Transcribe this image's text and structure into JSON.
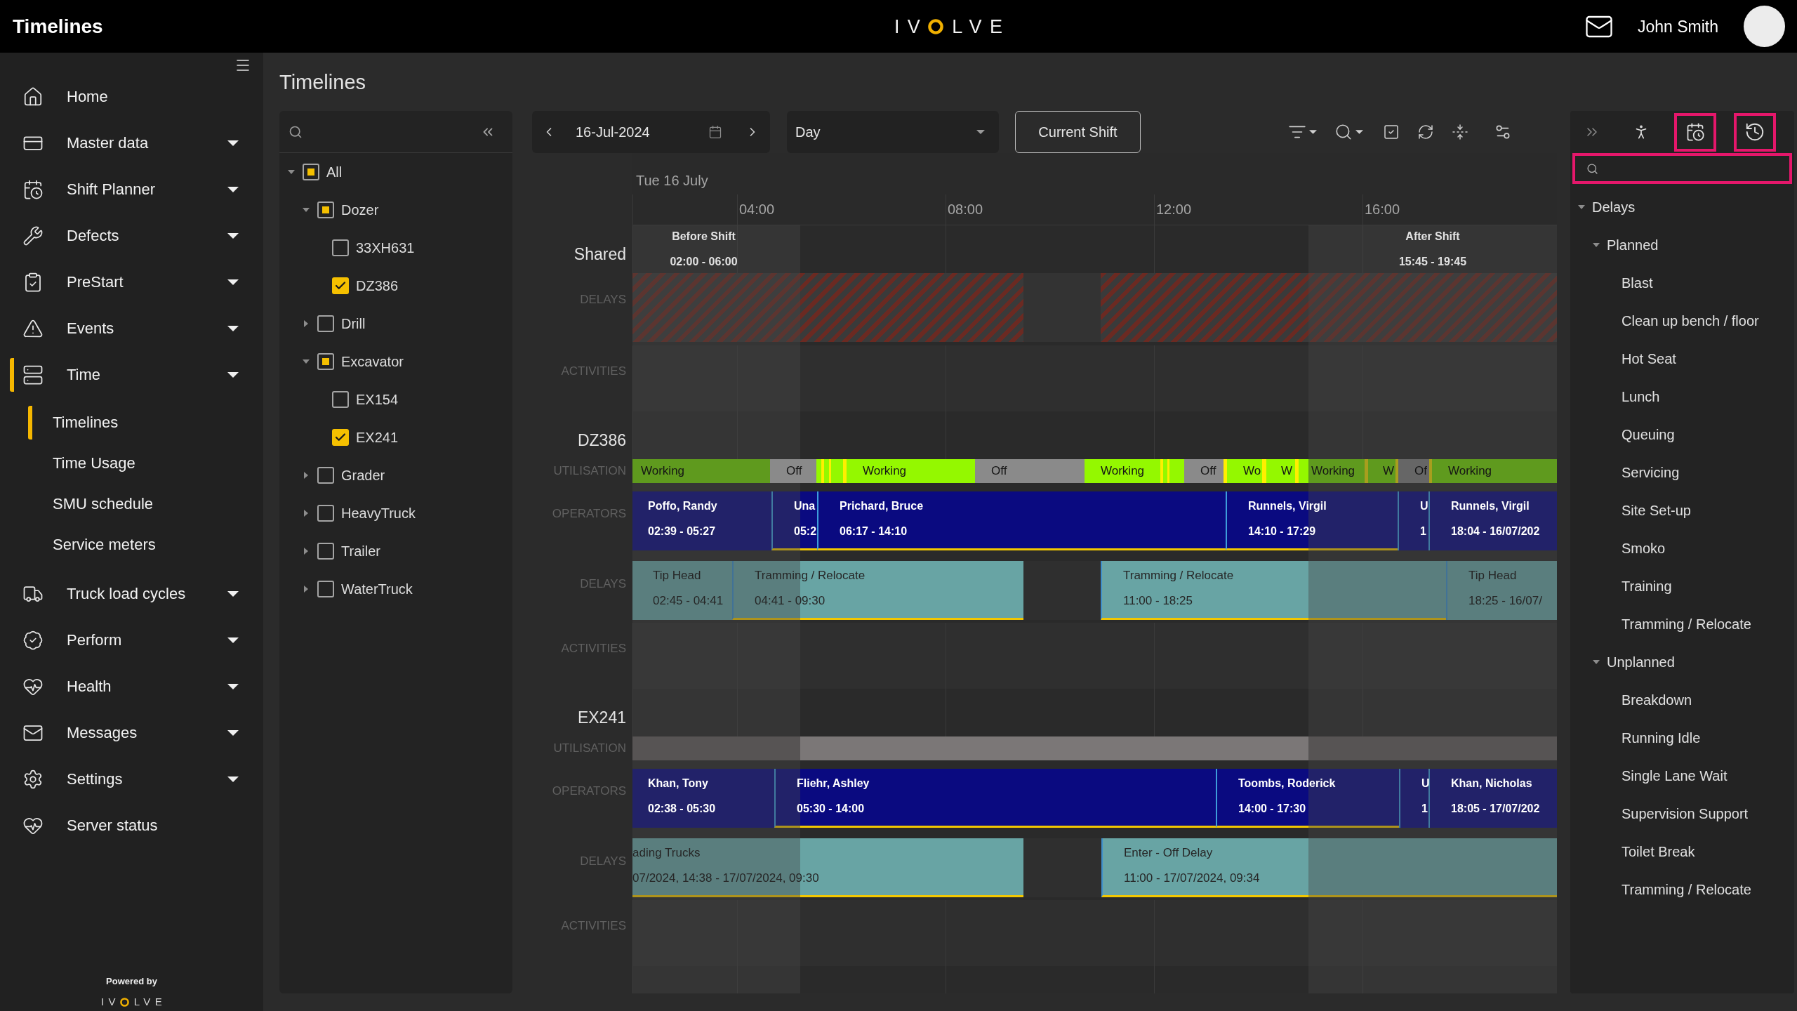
{
  "top_bar": {
    "title": "Timelines",
    "logo": [
      "IV",
      "LVE"
    ],
    "user_name": "John Smith"
  },
  "sidebar": {
    "items": [
      {
        "label": "Home",
        "expandable": false,
        "selected": false
      },
      {
        "label": "Master data",
        "expandable": true,
        "selected": false
      },
      {
        "label": "Shift Planner",
        "expandable": true,
        "selected": false
      },
      {
        "label": "Defects",
        "expandable": true,
        "selected": false
      },
      {
        "label": "PreStart",
        "expandable": true,
        "selected": false
      },
      {
        "label": "Events",
        "expandable": true,
        "selected": false
      },
      {
        "label": "Time",
        "expandable": true,
        "selected": true,
        "children": [
          {
            "label": "Timelines",
            "selected": true
          },
          {
            "label": "Time Usage",
            "selected": false
          },
          {
            "label": "SMU schedule",
            "selected": false
          },
          {
            "label": "Service meters",
            "selected": false
          }
        ]
      },
      {
        "label": "Truck load cycles",
        "expandable": true,
        "selected": false
      },
      {
        "label": "Perform",
        "expandable": true,
        "selected": false
      },
      {
        "label": "Health",
        "expandable": true,
        "selected": false
      },
      {
        "label": "Messages",
        "expandable": true,
        "selected": false
      },
      {
        "label": "Settings",
        "expandable": true,
        "selected": false
      },
      {
        "label": "Server status",
        "expandable": false,
        "selected": false
      }
    ],
    "footer": {
      "caption": "Powered by",
      "logo": [
        "IV",
        "LVE"
      ]
    }
  },
  "page_title": "Timelines",
  "equipment_tree": [
    {
      "label": "All",
      "expanded": true,
      "checked": false,
      "partial": true,
      "children": [
        {
          "label": "Dozer",
          "expanded": true,
          "checked": false,
          "partial": true,
          "children": [
            {
              "label": "33XH631",
              "checked": false,
              "partial": false
            },
            {
              "label": "DZ386",
              "checked": true,
              "partial": false
            }
          ]
        },
        {
          "label": "Drill",
          "expanded": false,
          "checked": false,
          "partial": false
        },
        {
          "label": "Excavator",
          "expanded": true,
          "checked": false,
          "partial": true,
          "children": [
            {
              "label": "EX154",
              "checked": false,
              "partial": false
            },
            {
              "label": "EX241",
              "checked": true,
              "partial": false
            }
          ]
        },
        {
          "label": "Grader",
          "expanded": false,
          "checked": false,
          "partial": false
        },
        {
          "label": "HeavyTruck",
          "expanded": false,
          "checked": false,
          "partial": false
        },
        {
          "label": "Trailer",
          "expanded": false,
          "checked": false,
          "partial": false
        },
        {
          "label": "WaterTruck",
          "expanded": false,
          "checked": false,
          "partial": false
        }
      ]
    }
  ],
  "toolbar": {
    "date": "16-Jul-2024",
    "view": "Day",
    "current_shift": "Current Shift"
  },
  "timeline": {
    "date": "Tue 16 July",
    "ticks": [
      "04:00",
      "08:00",
      "12:00",
      "16:00"
    ],
    "shifts": [
      {
        "title": "Before Shift",
        "time": "02:00 - 06:00"
      },
      {
        "title": "After Shift",
        "time": "15:45 - 19:45"
      }
    ],
    "groups": [
      {
        "label": "Shared",
        "lanes": [
          {
            "label": "DELAYS",
            "kind": "hatched"
          },
          {
            "label": "ACTIVITIES",
            "kind": "empty"
          }
        ]
      },
      {
        "label": "DZ386",
        "lanes": [
          {
            "label": "UTILISATION",
            "kind": "utilisation",
            "segments": [
              {
                "label": "Working",
                "color": "#5f9a1e"
              },
              {
                "label": "Off",
                "color": "#8a8a8a"
              },
              {
                "color": "#94f800"
              },
              {
                "color": "#ffee00"
              },
              {
                "color": "#94f800"
              },
              {
                "color": "#ffee00"
              },
              {
                "color": "#94f800"
              },
              {
                "color": "#ffee00"
              },
              {
                "label": "Working",
                "color": "#94f800"
              },
              {
                "label": "Off",
                "color": "#8a8a8a"
              },
              {
                "label": "Working",
                "color": "#94f800"
              },
              {
                "color": "#ffee00"
              },
              {
                "color": "#94f800"
              },
              {
                "color": "#ffee00"
              },
              {
                "color": "#94f800"
              },
              {
                "label": "Off",
                "color": "#8a8a8a"
              },
              {
                "color": "#ffee00"
              },
              {
                "label": "Wo",
                "color": "#94f800"
              },
              {
                "color": "#ffee00"
              },
              {
                "label": "W",
                "color": "#94f800"
              },
              {
                "color": "#ffee00"
              },
              {
                "color": "#94f800"
              },
              {
                "label": "Working",
                "color": "#5f9a1e"
              },
              {
                "color": "#a89e1e"
              },
              {
                "label": "W",
                "color": "#5f9a1e"
              },
              {
                "color": "#a89e1e"
              },
              {
                "label": "Of",
                "color": "#666666"
              },
              {
                "color": "#a89e1e"
              },
              {
                "label": "Working",
                "color": "#5f9a1e"
              }
            ]
          },
          {
            "label": "OPERATORS",
            "kind": "operators",
            "bars": [
              {
                "title": "Poffo, Randy",
                "time": "02:39 - 05:27",
                "highlighted": false
              },
              {
                "title": "Una",
                "time": "05:2",
                "highlighted": true
              },
              {
                "title": "Prichard, Bruce",
                "time": "06:17 - 14:10",
                "highlighted": true
              },
              {
                "title": "Runnels, Virgil",
                "time": "14:10 - 17:29",
                "highlighted": true
              },
              {
                "title": "U",
                "time": "1",
                "highlighted": false
              },
              {
                "title": "Runnels, Virgil",
                "time": "18:04 - 16/07/202",
                "highlighted": false
              }
            ]
          },
          {
            "label": "DELAYS",
            "kind": "delays",
            "bars": [
              {
                "title": "Tip Head",
                "time": "02:45 - 04:41",
                "highlighted": false
              },
              {
                "title": "Tramming / Relocate",
                "time": "04:41 - 09:30",
                "highlighted": true
              },
              {
                "title": "Tramming / Relocate",
                "time": "11:00 - 18:25",
                "highlighted": true
              },
              {
                "title": "Tip Head",
                "time": "18:25 - 16/07/",
                "highlighted": false
              }
            ]
          },
          {
            "label": "ACTIVITIES",
            "kind": "empty"
          }
        ]
      },
      {
        "label": "EX241",
        "lanes": [
          {
            "label": "UTILISATION",
            "kind": "utilisation",
            "segments": [
              {
                "color": "#575454"
              },
              {
                "color": "#7b7777"
              },
              {
                "color": "#575454"
              }
            ]
          },
          {
            "label": "OPERATORS",
            "kind": "operators",
            "bars": [
              {
                "title": "Khan, Tony",
                "time": "02:38 - 05:30",
                "highlighted": false
              },
              {
                "title": "Fliehr, Ashley",
                "time": "05:30 - 14:00",
                "highlighted": true
              },
              {
                "title": "Toombs, Roderick",
                "time": "14:00 - 17:30",
                "highlighted": true
              },
              {
                "title": "U",
                "time": "1",
                "highlighted": false
              },
              {
                "title": "Khan, Nicholas",
                "time": "18:05 - 17/07/202",
                "highlighted": false
              }
            ]
          },
          {
            "label": "DELAYS",
            "kind": "delays",
            "bars": [
              {
                "title": "ading Trucks",
                "time": "07/2024, 14:38 - 17/07/2024, 09:30",
                "highlighted": true
              },
              {
                "title": "Enter - Off Delay",
                "time": "11:00 - 17/07/2024, 09:34",
                "highlighted": true
              }
            ]
          },
          {
            "label": "ACTIVITIES",
            "kind": "empty"
          }
        ]
      }
    ]
  },
  "delay_panel": {
    "tools": [
      {
        "kind": "collapse",
        "annotated": false
      },
      {
        "kind": "operators",
        "annotated": false
      },
      {
        "kind": "schedule",
        "annotated": true
      },
      {
        "kind": "history",
        "annotated": true
      }
    ],
    "search": {
      "annotated": true
    },
    "tree": [
      {
        "label": "Delays",
        "expanded": true,
        "children": [
          {
            "label": "Planned",
            "expanded": true,
            "children": [
              {
                "label": "Blast"
              },
              {
                "label": "Clean up bench / floor"
              },
              {
                "label": "Hot Seat"
              },
              {
                "label": "Lunch"
              },
              {
                "label": "Queuing"
              },
              {
                "label": "Servicing"
              },
              {
                "label": "Site Set-up"
              },
              {
                "label": "Smoko"
              },
              {
                "label": "Training"
              },
              {
                "label": "Tramming / Relocate"
              }
            ]
          },
          {
            "label": "Unplanned",
            "expanded": true,
            "children": [
              {
                "label": "Breakdown"
              },
              {
                "label": "Running Idle"
              },
              {
                "label": "Single Lane Wait"
              },
              {
                "label": "Supervision Support"
              },
              {
                "label": "Toilet Break"
              },
              {
                "label": "Tramming / Relocate"
              }
            ]
          }
        ]
      }
    ]
  }
}
